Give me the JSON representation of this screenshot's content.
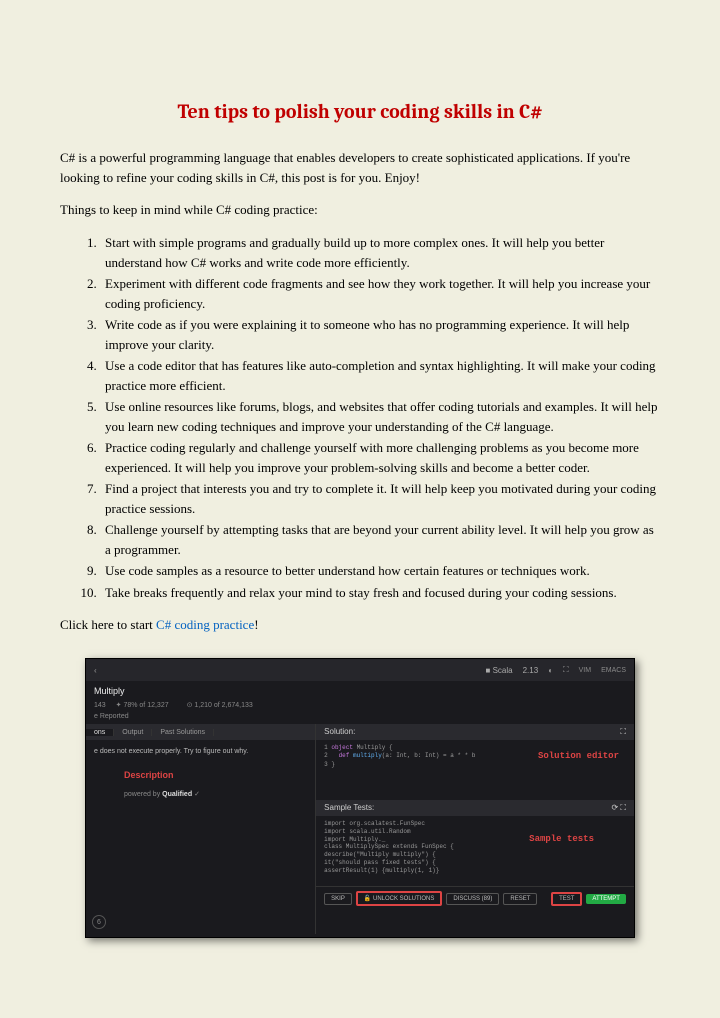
{
  "title": "Ten tips to polish your coding skills in C#",
  "intro": "C# is a powerful programming language that enables developers to create sophisticated applications. If you're looking to refine your coding skills in C#, this post is for you. Enjoy!",
  "subheading": "Things to keep in mind while C# coding practice:",
  "tips": [
    "Start with simple programs and gradually build up to more complex ones. It will help you better understand how C# works and write code more efficiently.",
    "Experiment with different code fragments and see how they work together. It will help you increase your coding proficiency.",
    "Write code as if you were explaining it to someone who has no programming experience. It will help improve your clarity.",
    "Use a code editor that has features like auto-completion and syntax highlighting. It will make your coding practice more efficient.",
    "Use online resources like forums, blogs, and websites that offer coding tutorials and examples. It will help you learn new coding techniques and improve your understanding of the C# language.",
    "Practice coding regularly and challenge yourself with more challenging problems as you become more experienced. It will help you improve your problem-solving skills and become a better coder.",
    "Find a project that interests you and try to complete it. It will help keep you motivated during your coding practice sessions.",
    "Challenge yourself by attempting tasks that are beyond your current ability level. It will help you grow as a programmer.",
    "Use code samples as a resource to better understand how certain features or techniques work.",
    "Take breaks frequently and relax your mind to stay fresh and focused during your coding sessions."
  ],
  "cta_prefix": "Click here to start ",
  "cta_link": "C# coding practice",
  "cta_suffix": "!",
  "screenshot": {
    "kata_title": "Multiply",
    "stats": {
      "rank": "143",
      "percent": "78% of 12,327",
      "completions": "1,210 of 2,674,133",
      "reported": "e Reported"
    },
    "lang": "Scala",
    "version": "2.13",
    "editor_modes": {
      "vim": "VIM",
      "emacs": "EMACS"
    },
    "left_tabs": [
      "ons",
      "Output",
      "Past Solutions"
    ],
    "left_msg": "e does not execute properly. Try to figure out why.",
    "desc_label": "Description",
    "powered_by": "powered by",
    "qualified": "Qualified",
    "solution_label": "Solution:",
    "code": {
      "l1": "object Multiply {",
      "l2": "  def multiply(a: Int, b: Int) = a * * b",
      "l3": "}"
    },
    "annotations": {
      "solution_editor": "Solution editor",
      "sample_tests": "Sample tests"
    },
    "sample_tests_label": "Sample Tests:",
    "sample_code": [
      "import org.scalatest.FunSpec",
      "import scala.util.Random",
      "import Multiply._",
      "",
      "class MultiplySpec extends FunSpec {",
      "  describe(\"Multiply multiply\") {",
      "    it(\"should pass fixed tests\") {",
      "      assertResult(1) {multiply(1, 1)}"
    ],
    "buttons": {
      "skip": "SKIP",
      "unlock": "UNLOCK SOLUTIONS",
      "discuss": "DISCUSS (89)",
      "reset": "RESET",
      "test": "TEST",
      "attempt": "ATTEMPT"
    },
    "kyu": "6"
  }
}
